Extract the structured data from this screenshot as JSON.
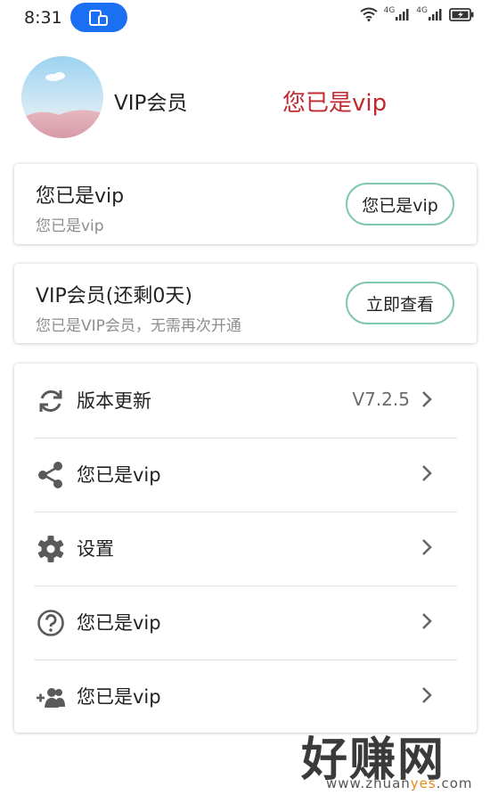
{
  "status_bar": {
    "time": "8:31",
    "signal_1_label": "4G",
    "signal_2_label": "4G"
  },
  "profile": {
    "name": "VIP会员",
    "vip_status": "您已是vip"
  },
  "card_vip": {
    "title": "您已是vip",
    "subtitle": "您已是vip",
    "button_label": "您已是vip"
  },
  "card_membership": {
    "title": "VIP会员(还剩0天)",
    "subtitle": "您已是VIP会员，无需再次开通",
    "button_label": "立即查看"
  },
  "menu": {
    "items": [
      {
        "icon": "refresh-icon",
        "label": "版本更新",
        "value": "V7.2.5"
      },
      {
        "icon": "share-icon",
        "label": "您已是vip"
      },
      {
        "icon": "gear-icon",
        "label": "设置"
      },
      {
        "icon": "help-icon",
        "label": "您已是vip"
      },
      {
        "icon": "add-group-icon",
        "label": "您已是vip"
      }
    ]
  },
  "watermark": {
    "brand": "好赚网",
    "domain_prefix": "www.zhuan",
    "domain_accent": "yes",
    "domain_suffix": ".com"
  },
  "colors": {
    "accent_blue": "#1b6ff2",
    "vip_red": "#c2282f",
    "button_border": "#7fc8a9",
    "watermark_accent": "#e58b18"
  }
}
